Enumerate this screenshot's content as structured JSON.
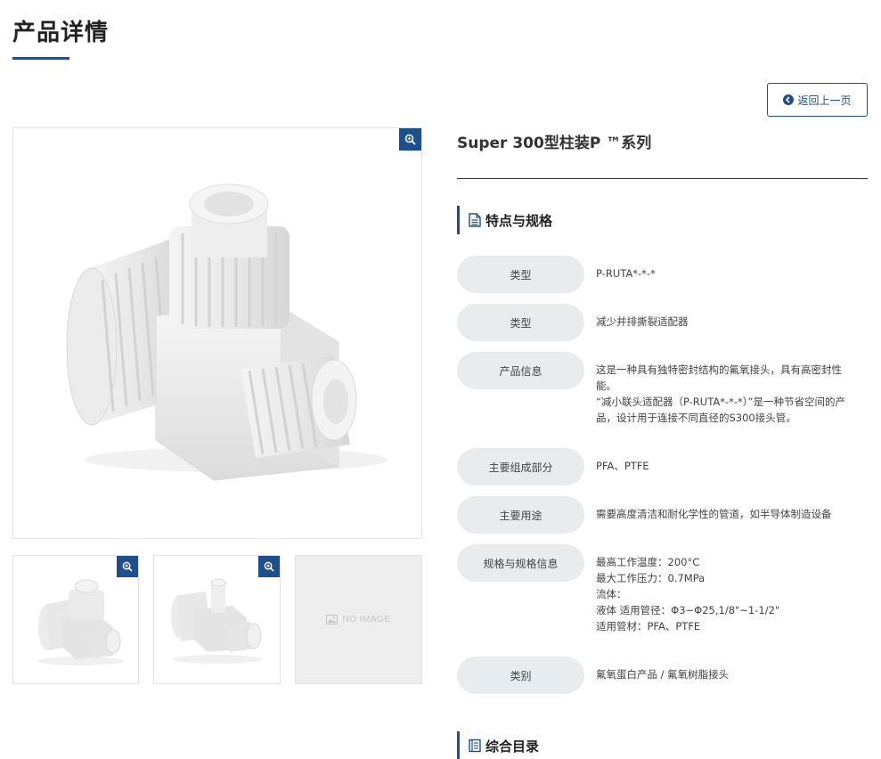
{
  "page_title": "产品详情",
  "back_button_label": "返回上一页",
  "product": {
    "name": "Super 300型柱装P ™系列"
  },
  "gallery": {
    "no_image_label": "NO IMAGE"
  },
  "features_section": {
    "heading": "特点与规格"
  },
  "specs": [
    {
      "label": "类型",
      "value": "P-RUTA*-*-*"
    },
    {
      "label": "类型",
      "value": "减少并排撕裂适配器"
    },
    {
      "label": "产品信息",
      "value": "这是一种具有独特密封结构的氟氧接头，具有高密封性能。\n“减小联头适配器（P-RUTA*-*-*）”是一种节省空间的产品，设计用于连接不同直径的S300接头管。"
    },
    {
      "label": "主要组成部分",
      "value": "PFA、PTFE"
    },
    {
      "label": "主要用途",
      "value": "需要高度清洁和耐化学性的管道，如半导体制造设备"
    },
    {
      "label": "规格与规格信息",
      "value": "最高工作温度：200°C\n最大工作压力：0.7MPa\n流体：\n液体 适用管径：Φ3~Φ25,1/8\"~1-1/2\"\n适用管材：PFA、PTFE"
    },
    {
      "label": "类别",
      "value": "氟氧蛋白产品 / 氟氧树脂接头"
    }
  ],
  "catalog_section": {
    "heading": "综合目录"
  },
  "colors": {
    "accent": "#1f4e8c",
    "label_bg": "#e8ecef"
  }
}
